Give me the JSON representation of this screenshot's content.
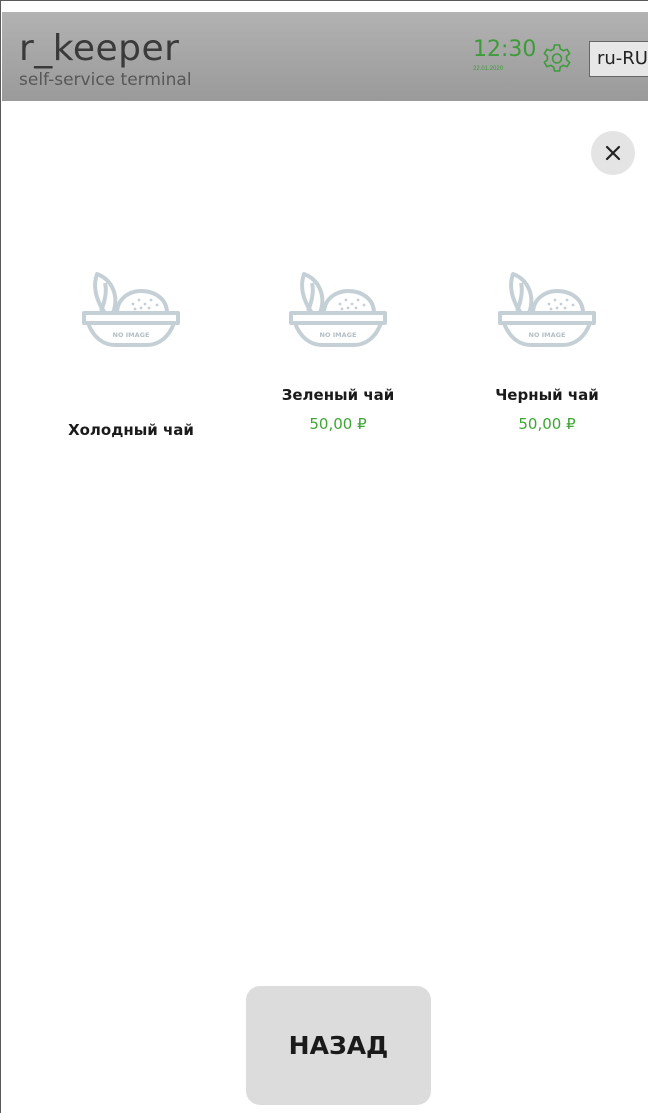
{
  "header": {
    "brand_name": "r_keeper",
    "brand_subtitle": "self-service terminal",
    "time": "12:30",
    "date": "22.01.2020",
    "settings_icon": "gear-icon",
    "language": "ru-RU"
  },
  "close_icon": "close-icon",
  "products": [
    {
      "name": "Холодный чай",
      "price": "",
      "image_placeholder": "NO IMAGE"
    },
    {
      "name": "Зеленый чай",
      "price": "50,00 ₽",
      "image_placeholder": "NO IMAGE"
    },
    {
      "name": "Черный чай",
      "price": "50,00 ₽",
      "image_placeholder": "NO IMAGE"
    }
  ],
  "back_button": "НАЗАД",
  "colors": {
    "accent": "#3ea535",
    "header_bg": "#a6a6a6",
    "placeholder_icon": "#c5d0d6"
  }
}
